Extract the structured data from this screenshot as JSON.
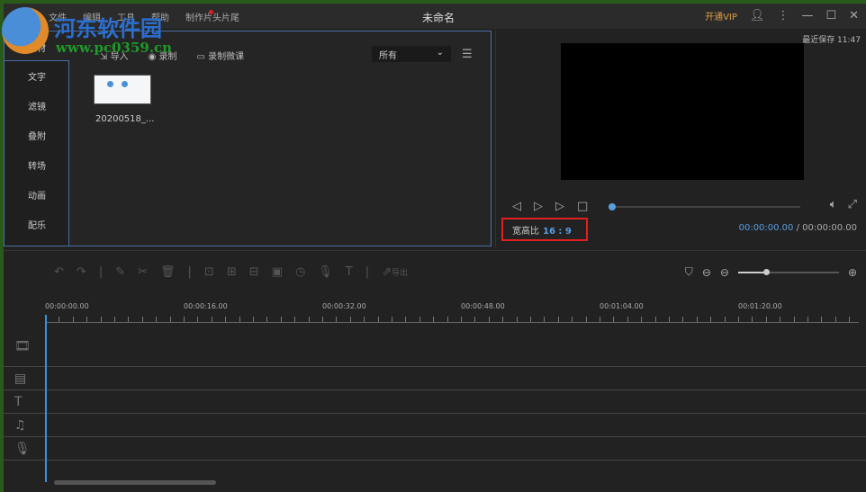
{
  "titlebar": {
    "menu": [
      "文件",
      "编辑",
      "工具",
      "帮助",
      "制作片头片尾"
    ],
    "title": "未命名",
    "vip": "开通VIP"
  },
  "library": {
    "active_tab": "素材",
    "sidebar": [
      "文字",
      "滤镜",
      "叠附",
      "转场",
      "动画",
      "配乐"
    ],
    "import": "导入",
    "record": "录制",
    "record_course": "录制微课",
    "filter": "所有",
    "item_name": "20200518_..."
  },
  "preview": {
    "saved": "最近保存 11:47",
    "ratio_label": "宽高比",
    "ratio_value": "16 : 9",
    "current_time": "00:00:00.00",
    "separator": "/",
    "total_time": "00:00:00.00",
    "progress": 0
  },
  "editbar": {
    "export": "导出",
    "zoom_level": 0.25
  },
  "timeline": {
    "ticks": [
      "00:00:00.00",
      "00:00:16.00",
      "00:00:32.00",
      "00:00:48.00",
      "00:01:04.00",
      "00:01:20.00"
    ]
  },
  "watermark": {
    "name": "河东软件园",
    "url": "www.pc0359.cn"
  }
}
